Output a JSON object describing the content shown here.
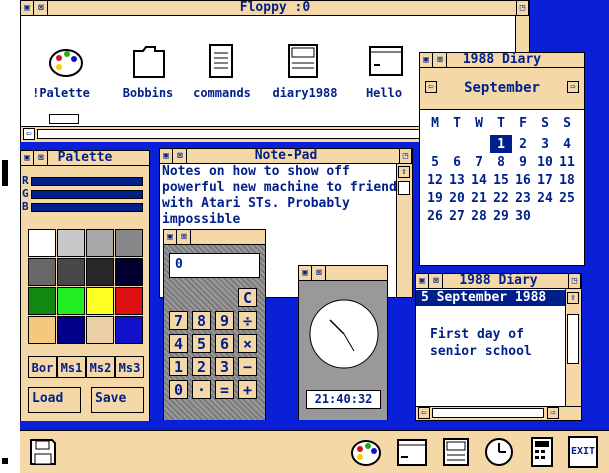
{
  "colors": {
    "desktop": "#0a20d8",
    "chrome": "#f5d8a8",
    "text": "#001f8a"
  },
  "filer": {
    "title": "Floppy :0",
    "icons": [
      {
        "label": "!Palette",
        "icon": "palette-icon"
      },
      {
        "label": "Bobbins",
        "icon": "folder-icon"
      },
      {
        "label": "commands",
        "icon": "document-icon"
      },
      {
        "label": "diary1988",
        "icon": "diary-icon"
      },
      {
        "label": "Hello",
        "icon": "notepad-icon"
      }
    ]
  },
  "diary_month": {
    "title": "1988 Diary",
    "month": "September",
    "weekdays": [
      "M",
      "T",
      "W",
      "T",
      "F",
      "S",
      "S"
    ],
    "weeks": [
      [
        "",
        "",
        "",
        "1",
        "2",
        "3",
        "4"
      ],
      [
        "5",
        "6",
        "7",
        "8",
        "9",
        "10",
        "11"
      ],
      [
        "12",
        "13",
        "14",
        "15",
        "16",
        "17",
        "18"
      ],
      [
        "19",
        "20",
        "21",
        "22",
        "23",
        "24",
        "25"
      ],
      [
        "26",
        "27",
        "28",
        "29",
        "30",
        "",
        ""
      ]
    ],
    "selected": "1"
  },
  "palette": {
    "title": "Palette",
    "sliders": [
      "R",
      "G",
      "B"
    ],
    "swatches": [
      "#ffffff",
      "#c8c8c8",
      "#a8a8a8",
      "#888888",
      "#686868",
      "#484848",
      "#282828",
      "#000030",
      "#118811",
      "#22ee22",
      "#ffff22",
      "#dd1111",
      "#f5c880",
      "#000088",
      "#ecd0a8",
      "#1111cc"
    ],
    "buttons": [
      "Bor",
      "Ms1",
      "Ms2",
      "Ms3"
    ],
    "load": "Load",
    "save": "Save"
  },
  "notepad": {
    "title": "Note-Pad",
    "lines": [
      "Notes on how to show off",
      "powerful new machine to friends",
      "with Atari STs. Probably",
      "impossible"
    ]
  },
  "calculator": {
    "display": "0",
    "keys": [
      "C",
      "7",
      "8",
      "9",
      "÷",
      "4",
      "5",
      "6",
      "×",
      "1",
      "2",
      "3",
      "−",
      "0",
      "·",
      "=",
      "+"
    ]
  },
  "clock": {
    "time": "21:40:32"
  },
  "diary_day": {
    "title": "1988 Diary",
    "date": "5 September 1988",
    "lines": [
      "First day of",
      "senior school"
    ]
  },
  "iconbar": {
    "left": "disk-icon",
    "right": [
      "palette-icon",
      "notepad-icon",
      "diary-icon",
      "clock-icon",
      "calculator-icon",
      "exit-icon"
    ],
    "exit_label": "EXIT"
  }
}
